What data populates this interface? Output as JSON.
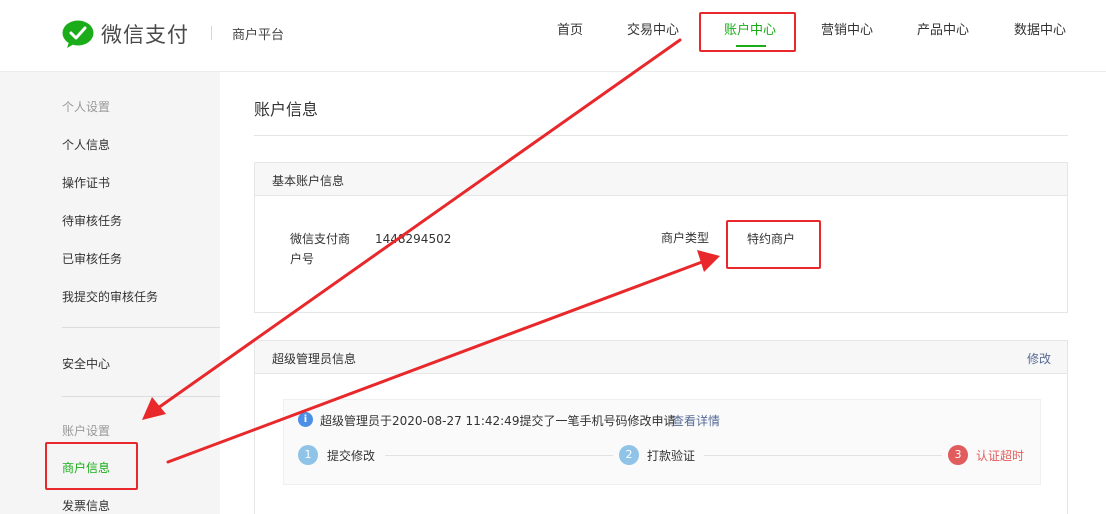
{
  "brand": {
    "logo_text": "微信支付",
    "platform": "商户平台",
    "logo_icon": "wechat-chat-icon",
    "brand_color": "#1aad19"
  },
  "nav": {
    "items": [
      {
        "label": "首页"
      },
      {
        "label": "交易中心"
      },
      {
        "label": "账户中心",
        "active": true
      },
      {
        "label": "营销中心"
      },
      {
        "label": "产品中心"
      },
      {
        "label": "数据中心"
      }
    ]
  },
  "sidebar": {
    "sections": [
      {
        "title": "个人设置",
        "items": [
          {
            "label": "个人信息"
          },
          {
            "label": "操作证书"
          },
          {
            "label": "待审核任务"
          },
          {
            "label": "已审核任务"
          },
          {
            "label": "我提交的审核任务"
          }
        ]
      },
      {
        "title": "",
        "items": [
          {
            "label": "安全中心"
          }
        ]
      },
      {
        "title": "账户设置",
        "items": [
          {
            "label": "商户信息",
            "active": true
          },
          {
            "label": "发票信息"
          }
        ]
      }
    ]
  },
  "main": {
    "page_title": "账户信息",
    "basic_panel": {
      "title": "基本账户信息",
      "merchant_id_label_line1": "微信支付商",
      "merchant_id_label_line2": "户号",
      "merchant_id_value": "1448294502",
      "merchant_type_label": "商户类型",
      "merchant_type_value": "特约商户"
    },
    "admin_panel": {
      "title": "超级管理员信息",
      "edit_link": "修改",
      "notice_icon": "info-icon",
      "notice_text": "超级管理员于2020-08-27 11:42:49提交了一笔手机号码修改申请",
      "notice_link": "查看详情",
      "steps": [
        {
          "number": "1",
          "label": "提交修改",
          "status": "done"
        },
        {
          "number": "2",
          "label": "打款验证",
          "status": "done"
        },
        {
          "number": "3",
          "label": "认证超时",
          "status": "error"
        }
      ],
      "step_done_color": "#8fc3e8",
      "step_error_color": "#e15c5c"
    }
  },
  "annotation": {
    "highlight_color": "#e8282b"
  }
}
